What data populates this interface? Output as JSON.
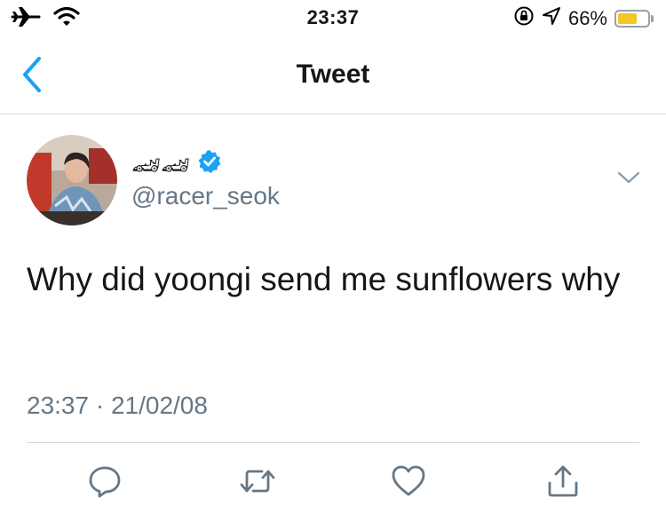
{
  "status_bar": {
    "time": "23:37",
    "battery_text": "66%",
    "battery_level": 0.66,
    "icons": [
      "airplane-icon",
      "wifi-icon",
      "orientation-lock-icon",
      "location-icon",
      "battery-icon"
    ]
  },
  "nav": {
    "title": "Tweet",
    "back_icon": "chevron-left-icon"
  },
  "tweet": {
    "display_name": "🏎🏎",
    "verified": true,
    "handle": "@racer_seok",
    "text": "Why did yoongi send me sunflowers why",
    "timestamp": "23:37 · 21/02/08"
  },
  "actions": [
    "reply-icon",
    "retweet-icon",
    "like-icon",
    "share-icon"
  ],
  "colors": {
    "accent": "#1da1f2",
    "text": "#14171a",
    "secondary_text": "#657786",
    "divider": "#d5d8db",
    "battery_fill": "#f2c623"
  }
}
